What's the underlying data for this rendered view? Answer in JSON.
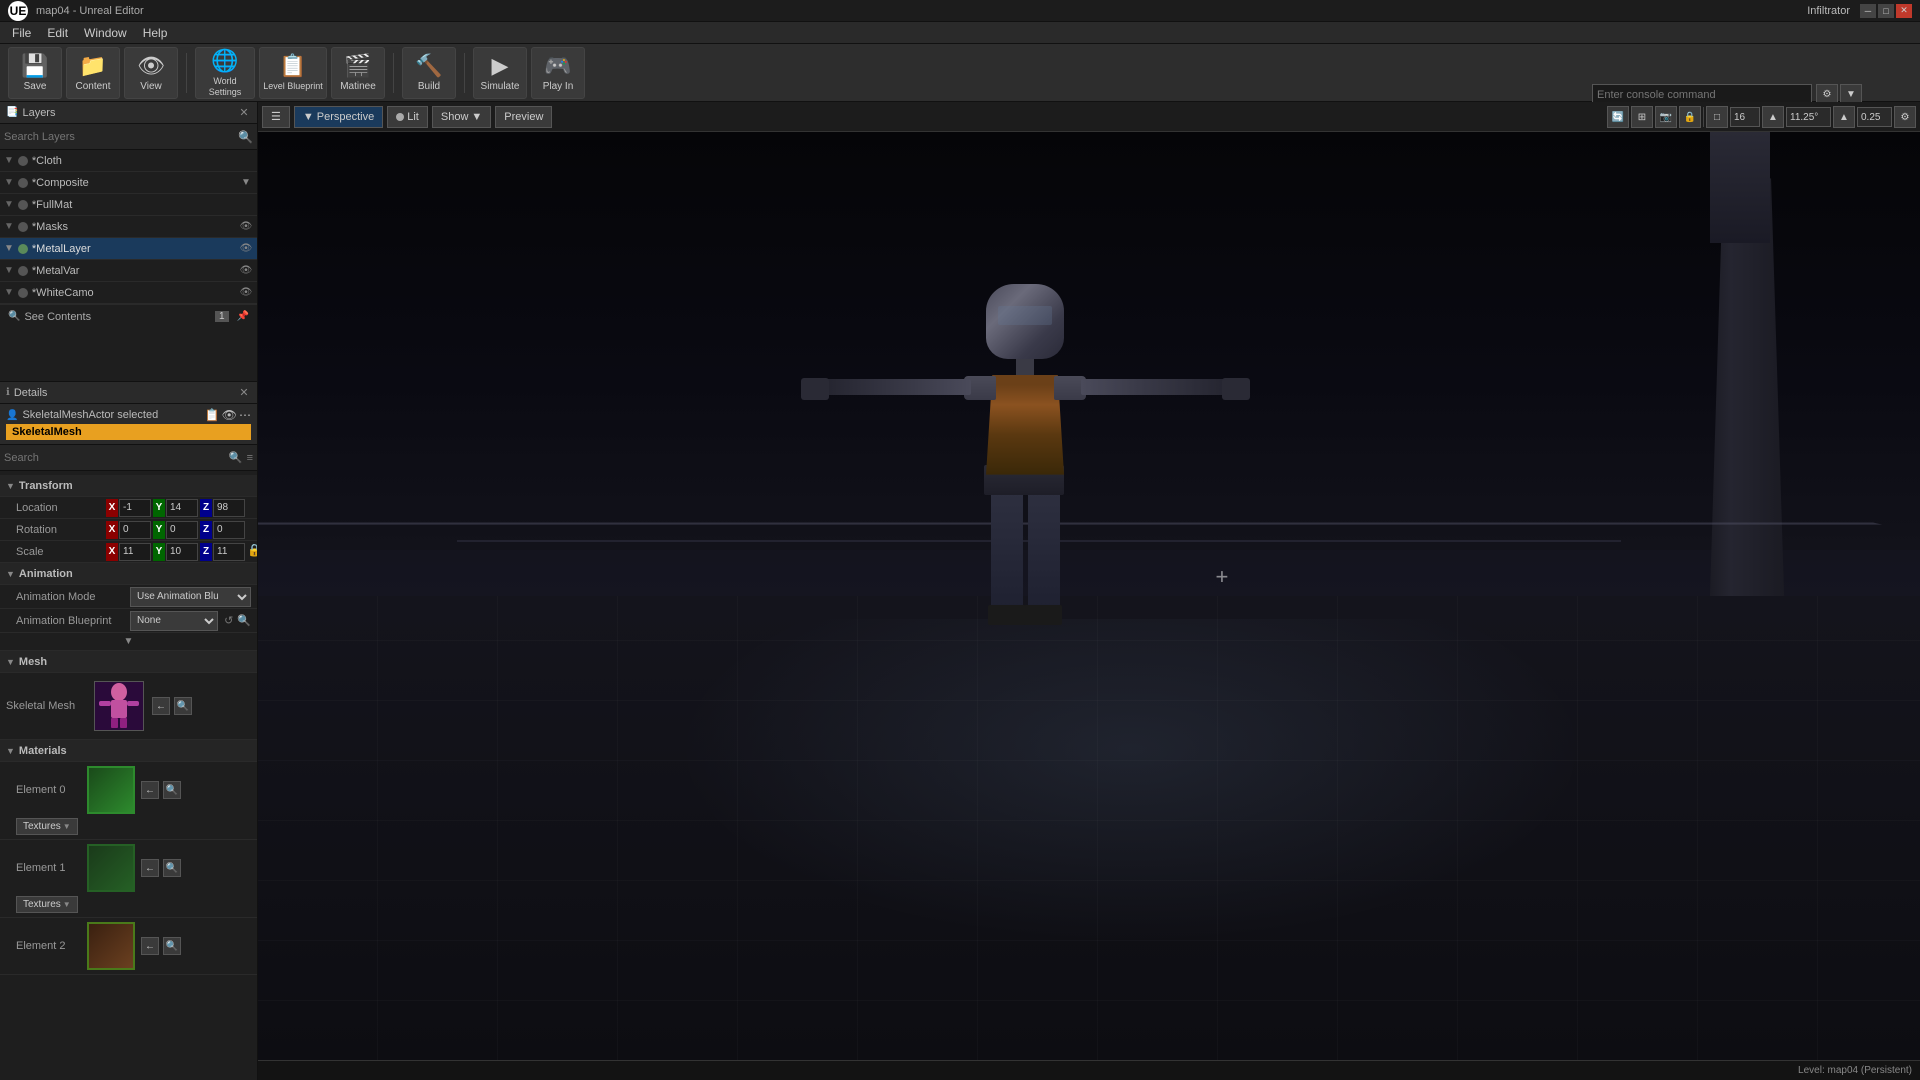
{
  "app": {
    "name": "Infiltrator",
    "title": "map04 - Unreal Editor",
    "logo": "UE"
  },
  "titlebar": {
    "title": "map04 - Unreal Editor",
    "buttons": [
      "minimize",
      "maximize",
      "close"
    ]
  },
  "menubar": {
    "items": [
      "File",
      "Edit",
      "Window",
      "Help"
    ]
  },
  "toolbar": {
    "buttons": [
      {
        "id": "save",
        "label": "Save",
        "icon": "💾"
      },
      {
        "id": "content",
        "label": "Content",
        "icon": "📁"
      },
      {
        "id": "view",
        "label": "View",
        "icon": "👁"
      },
      {
        "id": "world-settings",
        "label": "World Settings",
        "icon": "🌐"
      },
      {
        "id": "level-blueprint",
        "label": "Level Blueprint",
        "icon": "📋"
      },
      {
        "id": "matinee",
        "label": "Matinee",
        "icon": "🎬"
      },
      {
        "id": "build",
        "label": "Build",
        "icon": "🔨"
      },
      {
        "id": "simulate",
        "label": "Simulate",
        "icon": "▶"
      },
      {
        "id": "play-in",
        "label": "Play In",
        "icon": "🎮"
      }
    ],
    "console_placeholder": "Enter console command"
  },
  "layers": {
    "panel_title": "Layers",
    "search_placeholder": "Search Layers",
    "items": [
      {
        "name": "*Cloth",
        "has_eye": false,
        "active": false
      },
      {
        "name": "*Composite",
        "has_eye": false,
        "active": false
      },
      {
        "name": "*FullMat",
        "has_eye": false,
        "active": false
      },
      {
        "name": "*Masks",
        "has_eye": true,
        "active": false
      },
      {
        "name": "*MetalLayer",
        "has_eye": true,
        "active": true
      },
      {
        "name": "*MetalVar",
        "has_eye": true,
        "active": false
      },
      {
        "name": "*WhiteCamo",
        "has_eye": true,
        "active": false
      }
    ],
    "see_contents": "See Contents",
    "see_contents_count": "1"
  },
  "details": {
    "panel_title": "Details",
    "actor_label": "SkeletalMeshActor selected",
    "component_label": "SkeletalMesh",
    "search_placeholder": "Search",
    "transform": {
      "section": "Transform",
      "location": {
        "label": "Location",
        "x": "-1",
        "y": "14",
        "z": "98"
      },
      "rotation": {
        "label": "Rotation",
        "x": "0",
        "y": "0",
        "z": "0"
      },
      "scale": {
        "label": "Scale",
        "x": "11",
        "y": "10",
        "z": "11"
      }
    },
    "animation": {
      "section": "Animation",
      "mode_label": "Animation Mode",
      "mode_value": "Use Animation Blu",
      "blueprint_label": "Animation Blueprint",
      "blueprint_value": "None"
    },
    "mesh": {
      "section": "Mesh",
      "label": "Skeletal Mesh"
    },
    "materials": {
      "section": "Materials",
      "items": [
        {
          "label": "Element 0",
          "type": "green",
          "dropdown": "Textures"
        },
        {
          "label": "Element 1",
          "type": "green2",
          "dropdown": "Textures"
        },
        {
          "label": "Element 2",
          "type": "brown",
          "dropdown": "Textures"
        }
      ]
    }
  },
  "viewport": {
    "mode": "Perspective",
    "lighting": "Lit",
    "show_label": "Show",
    "preview_label": "Preview",
    "crosshair": "+",
    "tools": {
      "grid_size": "16",
      "angle": "11.25°",
      "scale": "0.25"
    },
    "status": "Level:  map04 (Persistent)"
  }
}
